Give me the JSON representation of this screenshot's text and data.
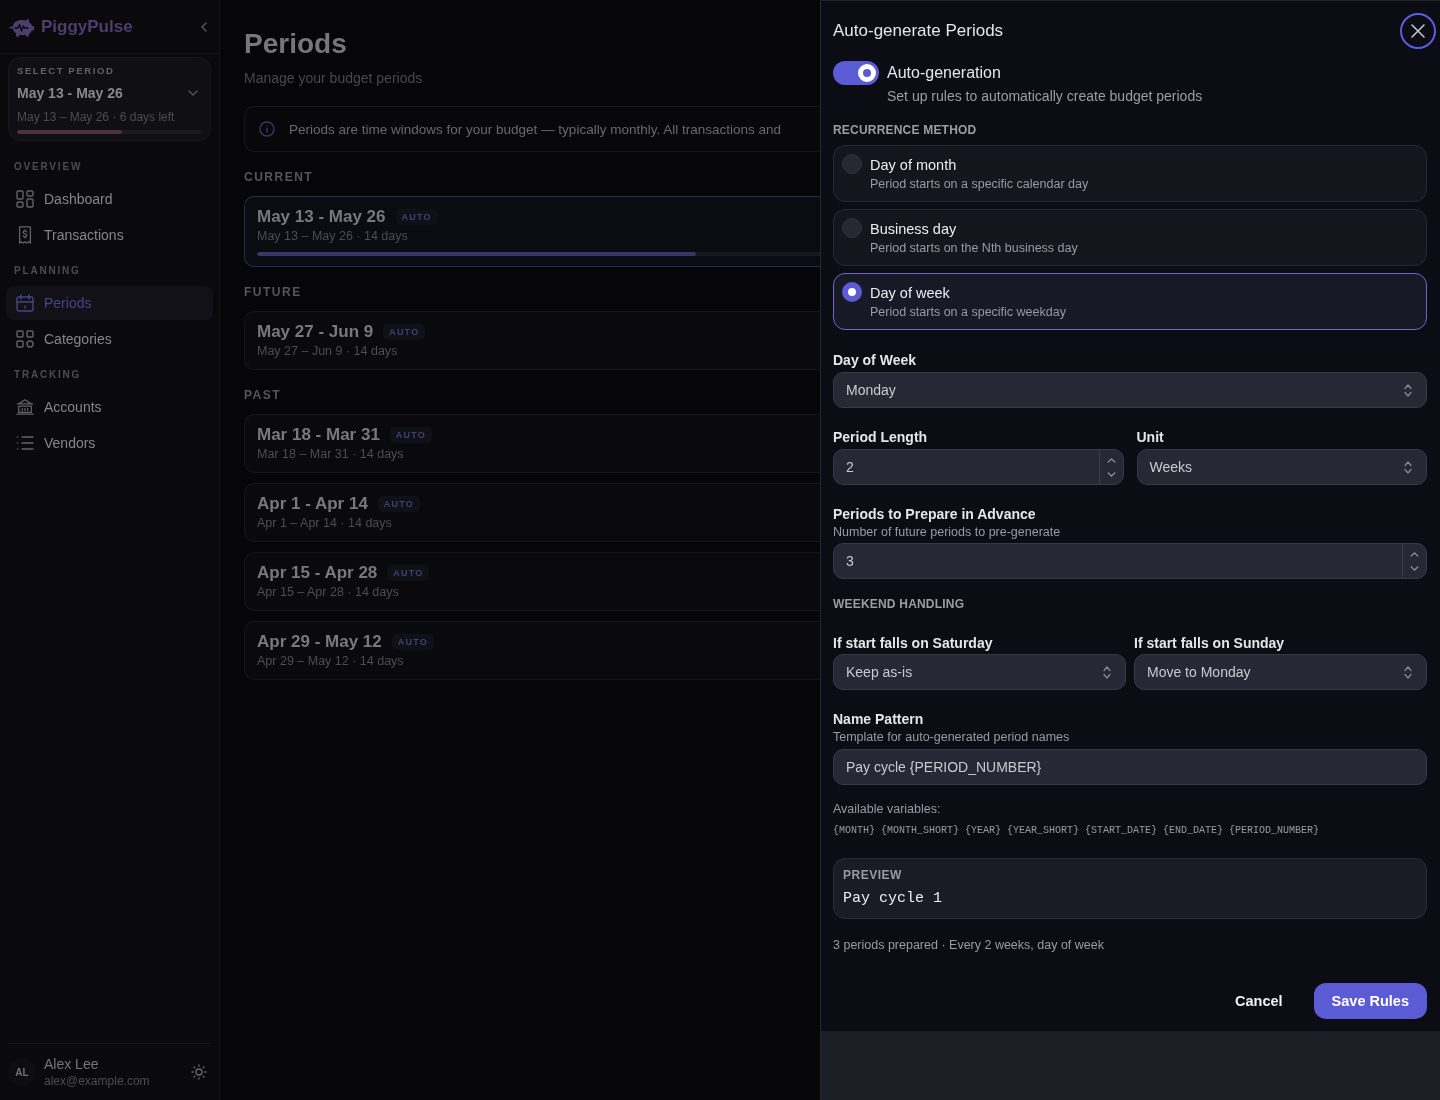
{
  "sidebar": {
    "brand": "PiggyPulse",
    "period_selector": {
      "label": "SELECT PERIOD",
      "value": "May 13 - May 26",
      "detail": "May 13 – May 26 · 6 days left",
      "level": 0.57
    },
    "sections": [
      {
        "title": "OVERVIEW",
        "items": [
          {
            "label": "Dashboard",
            "selected": false
          },
          {
            "label": "Transactions",
            "selected": false
          }
        ]
      },
      {
        "title": "PLANNING",
        "items": [
          {
            "label": "Periods",
            "selected": true
          },
          {
            "label": "Categories",
            "selected": false
          }
        ]
      },
      {
        "title": "TRACKING",
        "items": [
          {
            "label": "Accounts",
            "selected": false
          },
          {
            "label": "Vendors",
            "selected": false
          }
        ]
      }
    ],
    "user": {
      "initials": "AL",
      "name": "Alex Lee",
      "email": "alex@example.com"
    }
  },
  "main": {
    "title": "Periods",
    "subtitle": "Manage your budget periods",
    "info": "Periods are time windows for your budget — typically monthly. All transactions and",
    "groups": [
      {
        "title": "CURRENT",
        "periods": [
          {
            "title": "May 13 - May 26",
            "badge": "AUTO",
            "detail": "May 13 – May 26 · 14 days",
            "current": true,
            "level": 0.78
          }
        ]
      },
      {
        "title": "FUTURE",
        "periods": [
          {
            "title": "May 27 - Jun 9",
            "badge": "AUTO",
            "detail": "May 27 – Jun 9 · 14 days",
            "current": false
          }
        ]
      },
      {
        "title": "PAST",
        "periods": [
          {
            "title": "Mar 18 - Mar 31",
            "badge": "AUTO",
            "detail": "Mar 18 – Mar 31 · 14 days",
            "current": false
          },
          {
            "title": "Apr 1 - Apr 14",
            "badge": "AUTO",
            "detail": "Apr 1 – Apr 14 · 14 days",
            "current": false
          },
          {
            "title": "Apr 15 - Apr 28",
            "badge": "AUTO",
            "detail": "Apr 15 – Apr 28 · 14 days",
            "current": false
          },
          {
            "title": "Apr 29 - May 12",
            "badge": "AUTO",
            "detail": "Apr 29 – May 12 · 14 days",
            "current": false
          }
        ]
      }
    ]
  },
  "drawer": {
    "title": "Auto-generate Periods",
    "toggle": {
      "label": "Auto-generation",
      "description": "Set up rules to automatically create budget periods",
      "on": true
    },
    "recurrence": {
      "heading": "RECURRENCE METHOD",
      "options": [
        {
          "title": "Day of month",
          "description": "Period starts on a specific calendar day",
          "selected": false
        },
        {
          "title": "Business day",
          "description": "Period starts on the Nth business day",
          "selected": false
        },
        {
          "title": "Day of week",
          "description": "Period starts on a specific weekday",
          "selected": true
        }
      ]
    },
    "day_of_week": {
      "label": "Day of Week",
      "kind": "select",
      "value": "Monday"
    },
    "period_length": {
      "label": "Period Length",
      "kind": "number",
      "value": "2"
    },
    "unit": {
      "label": "Unit",
      "kind": "select",
      "value": "Weeks"
    },
    "advance": {
      "label": "Periods to Prepare in Advance",
      "description": "Number of future periods to pre-generate",
      "kind": "number",
      "value": "3"
    },
    "weekend": {
      "heading": "WEEKEND HANDLING",
      "saturday": {
        "label": "If start falls on Saturday",
        "kind": "select",
        "value": "Keep as-is"
      },
      "sunday": {
        "label": "If start falls on Sunday",
        "kind": "select",
        "value": "Move to Monday"
      }
    },
    "name_pattern": {
      "label": "Name Pattern",
      "description": "Template for auto-generated period names",
      "kind": "text",
      "value": "Pay cycle {PERIOD_NUMBER}"
    },
    "variables": {
      "label": "Available variables:",
      "items": [
        "{MONTH}",
        "{MONTH_SHORT}",
        "{YEAR}",
        "{YEAR_SHORT}",
        "{START_DATE}",
        "{END_DATE}",
        "{PERIOD_NUMBER}"
      ]
    },
    "preview": {
      "label": "PREVIEW",
      "value": "Pay cycle 1"
    },
    "summary": "3 periods prepared · Every 2 weeks, day of week",
    "buttons": [
      {
        "label": "Cancel",
        "kind": "text"
      },
      {
        "label": "Save Rules",
        "kind": "primary"
      }
    ]
  }
}
